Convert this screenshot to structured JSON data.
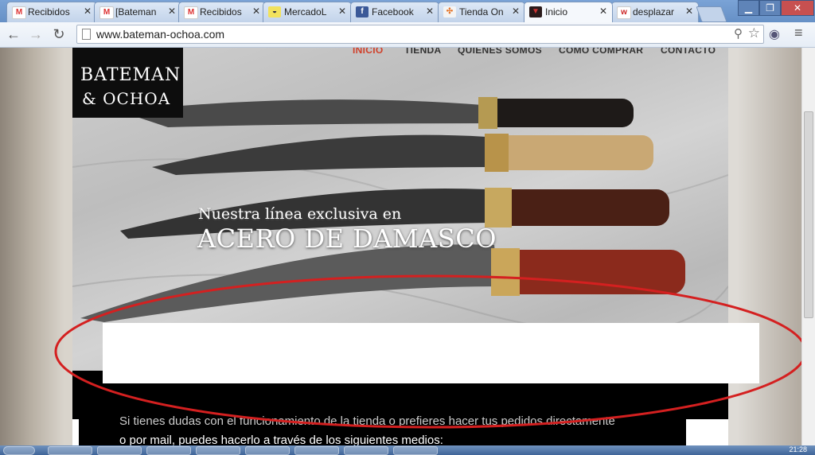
{
  "browser": {
    "tabs": [
      {
        "label": "Recibidos",
        "icon": "gmail-icon",
        "active": false
      },
      {
        "label": "[Bateman",
        "icon": "gmail-icon",
        "active": false
      },
      {
        "label": "Recibidos",
        "icon": "gmail-icon",
        "active": false
      },
      {
        "label": "MercadoL",
        "icon": "mercadolibre-icon",
        "active": false
      },
      {
        "label": "Facebook",
        "icon": "facebook-icon",
        "active": false
      },
      {
        "label": "Tienda On",
        "icon": "joomla-icon",
        "active": false
      },
      {
        "label": "Inicio",
        "icon": "site-icon",
        "active": true
      },
      {
        "label": "desplazar",
        "icon": "w-icon",
        "active": false
      }
    ],
    "url": "www.bateman-ochoa.com"
  },
  "site": {
    "nav": [
      "INICIO",
      "TIENDA",
      "QUIENES SOMOS",
      "COMO COMPRAR",
      "CONTACTO"
    ],
    "logo_line1": "BATEMAN",
    "logo_line2": "& OCHOA",
    "hero_line1": "Nuestra línea exclusiva en",
    "hero_line2": "ACERO DE DAMASCO",
    "body_line1": "Si tienes dudas con el funcionamiento de la tienda o prefieres hacer tus pedidos directamente",
    "body_line2": "o por mail, puedes hacerlo a través de los siguientes medios:"
  },
  "taskbar": {
    "clock": "21:28"
  },
  "colors": {
    "accent_nav": "#d0402a",
    "annotation": "#d42020"
  }
}
